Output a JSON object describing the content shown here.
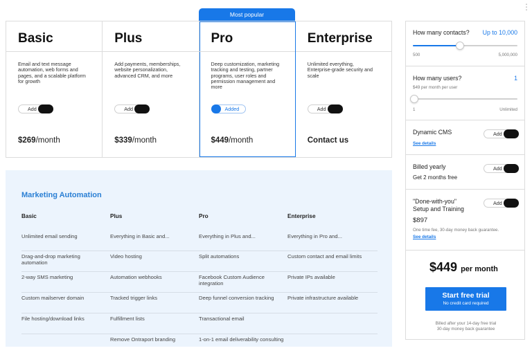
{
  "badge": "Most popular",
  "plans": [
    {
      "name": "Basic",
      "desc": "Email and text message automation, web forms and pages, and a scalable platform for growth",
      "toggle": "Add",
      "price": "$269",
      "per": "/month"
    },
    {
      "name": "Plus",
      "desc": "Add payments, memberships, website personalization, advanced CRM, and more",
      "toggle": "Add",
      "price": "$339",
      "per": "/month"
    },
    {
      "name": "Pro",
      "desc": "Deep customization, marketing tracking and testing, partner programs, user roles and permission management and more",
      "toggle": "Added",
      "price": "$449",
      "per": "/month"
    },
    {
      "name": "Enterprise",
      "desc": "Unlimited everything, Enterprise-grade security and scale",
      "toggle": "Add",
      "price": "Contact us",
      "per": ""
    }
  ],
  "features": {
    "title": "Marketing Automation",
    "headers": [
      "Basic",
      "Plus",
      "Pro",
      "Enterprise"
    ],
    "rows": [
      [
        "Unlimited email sending",
        "Everything in Basic and...",
        "Everything in Plus and...",
        "Everything in Pro and..."
      ],
      [
        "Drag-and-drop marketing automation",
        "Video hosting",
        "Split automations",
        "Custom contact and email limits"
      ],
      [
        "2-way SMS marketing",
        "Automation webhooks",
        "Facebook Custom Audience integration",
        "Private IPs available"
      ],
      [
        "Custom mailserver domain",
        "Tracked trigger links",
        "Deep funnel conversion tracking",
        "Private infrastructure available"
      ],
      [
        "File hosting/download links",
        "Fulfillment lists",
        "Transactional email",
        ""
      ],
      [
        "",
        "Remove Ontraport branding",
        "1-on-1 email deliverability consulting",
        ""
      ]
    ]
  },
  "sidebar": {
    "contacts_label": "How many contacts?",
    "contacts_value": "Up to 10,000",
    "contacts_min": "500",
    "contacts_max": "5,000,000",
    "contacts_level": 0.45,
    "users_label": "How many users?",
    "users_value": "1",
    "users_note": "$49 per month per user",
    "users_min": "1",
    "users_max": "Unlimited",
    "users_level": 0.0,
    "cms_label": "Dynamic CMS",
    "cms_link": "See details",
    "cms_toggle": "Add",
    "yearly_label": "Billed yearly",
    "yearly_note": "Get 2 months free",
    "yearly_toggle": "Add",
    "dwy_label_1": "\"Done-with-you\"",
    "dwy_label_2": "Setup and Training",
    "dwy_price": "$897",
    "dwy_note": "One time fee, 30-day money back guarantee.",
    "dwy_link": "See details",
    "dwy_toggle": "Add",
    "total": "$449",
    "total_per": "per month",
    "cta_main": "Start free trial",
    "cta_sub": "No credit card required",
    "billed_1": "Billed after your 14-day free trial",
    "billed_2": "30-day money back guarantee"
  },
  "colors": {
    "accent": "#1878e8",
    "feature_bg": "#ecf4fd",
    "feature_title": "#2a7fd4"
  }
}
